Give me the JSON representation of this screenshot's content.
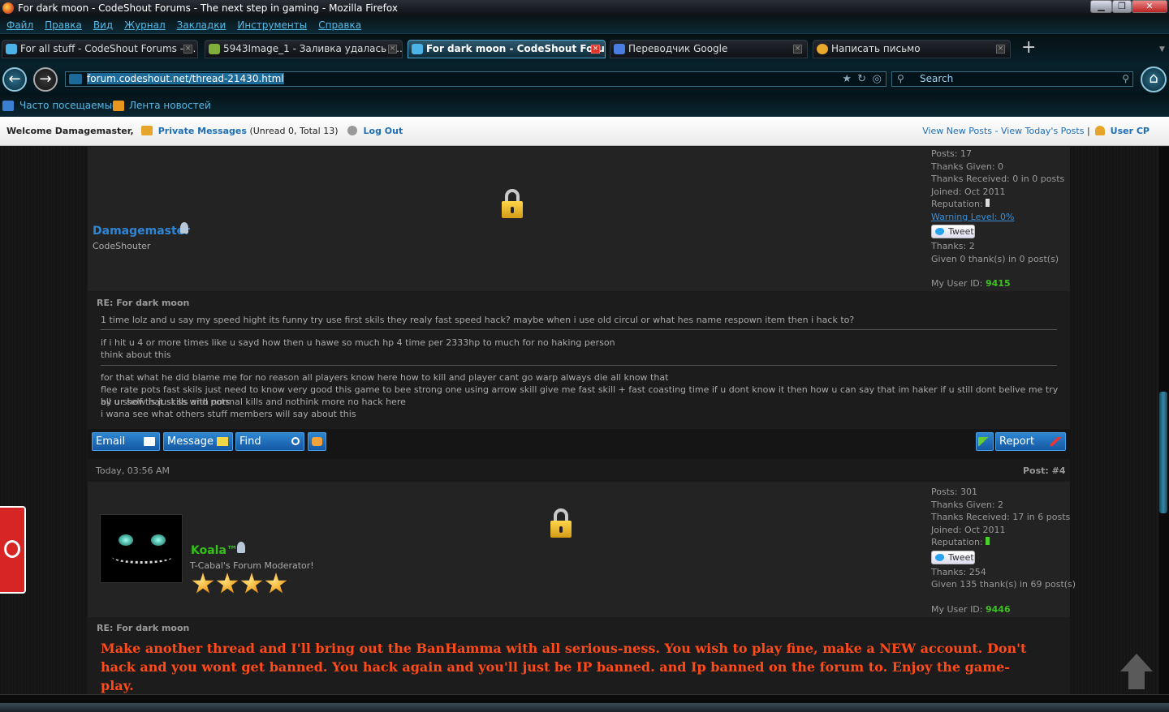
{
  "window": {
    "title": "For dark moon - CodeShout Forums - The next step in gaming - Mozilla Firefox",
    "min": "▁",
    "max": "❐",
    "close": "✕"
  },
  "menu": [
    "Файл",
    "Правка",
    "Вид",
    "Журнал",
    "Закладки",
    "Инструменты",
    "Справка"
  ],
  "tabs": [
    {
      "label": "For all stuff - CodeShout Forums - ..."
    },
    {
      "label": "5943Image_1 - Заливка удалась -..."
    },
    {
      "label": "For dark moon - CodeShout Foru..."
    },
    {
      "label": "Переводчик Google"
    },
    {
      "label": "Написать письмо"
    }
  ],
  "newtab": "+",
  "nav": {
    "back": "←",
    "forward": "→",
    "url": "forum.codeshout.net/thread-21430.html",
    "search_placeholder": "Search",
    "home": "⌂"
  },
  "bookmarks": [
    "Часто посещаемые",
    "Лента новостей"
  ],
  "welcome": {
    "greeting": "Welcome Damagemaster,",
    "pm_link": "Private Messages",
    "pm_count": "(Unread 0, Total 13)",
    "logout": "Log Out",
    "view_new": "View New Posts",
    "dash": "-",
    "view_today": "View Today's Posts",
    "pipe": "|",
    "user_cp": "User CP"
  },
  "post3": {
    "author": "Damagemaster",
    "author_title": "CodeShouter",
    "stats": {
      "posts": "Posts: 17",
      "thanks_given": "Thanks Given: 0",
      "thanks_received": "Thanks Received: 0 in 0 posts",
      "joined": "Joined: Oct 2011",
      "reputation": "Reputation:",
      "warning": "Warning Level: 0%",
      "tweet": "Tweet",
      "thanks": "Thanks: 2",
      "given": "Given 0 thank(s) in 0 post(s)",
      "user_id_label": "My User ID:",
      "user_id": "9415"
    },
    "subject": "RE: For dark moon",
    "line1": "1 time lolz and u say my speed hight its funny try use first skils they realy fast speed hack? maybe when i use old circul or what hes name respown item then i hack to?",
    "line2": "if i hit u 4 or more times like u sayd how then u hawe so much hp 4 time per 2333hp to much for no haking person",
    "line3": "think about this",
    "line4": "for that what he did blame me for no reason all players know here how to kill and player cant go warp always die all know that",
    "line5": "flee rate pots fast skils just need to know very good this game to bee strong one using arrow skill give me fast skill + fast coasting time if u dont know it then how u can say that im haker if u still dont belive me try by ur self that skills and pots",
    "line6": "all u show is just ss with normal kills and nothink more no hack here",
    "line7": "i wana see what others stuff members will say about this",
    "buttons": {
      "email": "Email",
      "message": "Message",
      "find": "Find",
      "report": "Report"
    }
  },
  "post4": {
    "date": "Today, 03:56 AM",
    "postnum": "Post: #4",
    "author": "Koala™",
    "author_title": "T-Cabal's Forum Moderator!",
    "stars": 4,
    "stats": {
      "posts": "Posts: 301",
      "thanks_given": "Thanks Given: 2",
      "thanks_received": "Thanks Received: 17 in 6 posts",
      "joined": "Joined: Oct 2011",
      "reputation": "Reputation:",
      "tweet": "Tweet",
      "thanks": "Thanks: 254",
      "given": "Given 135 thank(s) in 69 post(s)",
      "user_id_label": "My User ID:",
      "user_id": "9446"
    },
    "subject": "RE: For dark moon",
    "body": "Make another thread and I'll bring out the BanHamma with all serious-ness. You wish to play fine, make a NEW account. Don't hack and you wont get banned. You hack again and you'll just be IP banned. and Ip banned on the forum to. Enjoy the game-play."
  },
  "colors": {
    "link": "#1e6eb5",
    "koala": "#36c01c",
    "userid": "#3fbf22",
    "warning": "#3a8fd8",
    "mod_text": "#ff4a1a"
  }
}
